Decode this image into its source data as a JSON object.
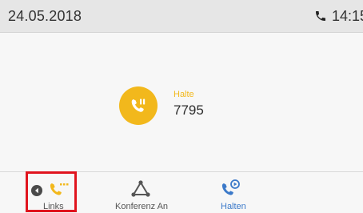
{
  "status_bar": {
    "date": "24.05.2018",
    "time": "14:15",
    "phone_icon": "phone-icon"
  },
  "call": {
    "avatar_icon": "call-hold-icon",
    "avatar_color": "#f2b81c",
    "state": "Halte",
    "number": "7795"
  },
  "softkeys": {
    "links": {
      "label": "Links",
      "icon": "handset-left-icon",
      "highlight_color": "#e0141e"
    },
    "konferenz": {
      "label": "Konferenz An",
      "icon": "conference-triangle-icon"
    },
    "halten": {
      "label": "Halten",
      "icon": "handset-hold-icon",
      "color": "#3b79c9"
    }
  },
  "colors": {
    "accent_yellow": "#f2b81c",
    "accent_blue": "#3b79c9",
    "highlight_red": "#e0141e"
  }
}
